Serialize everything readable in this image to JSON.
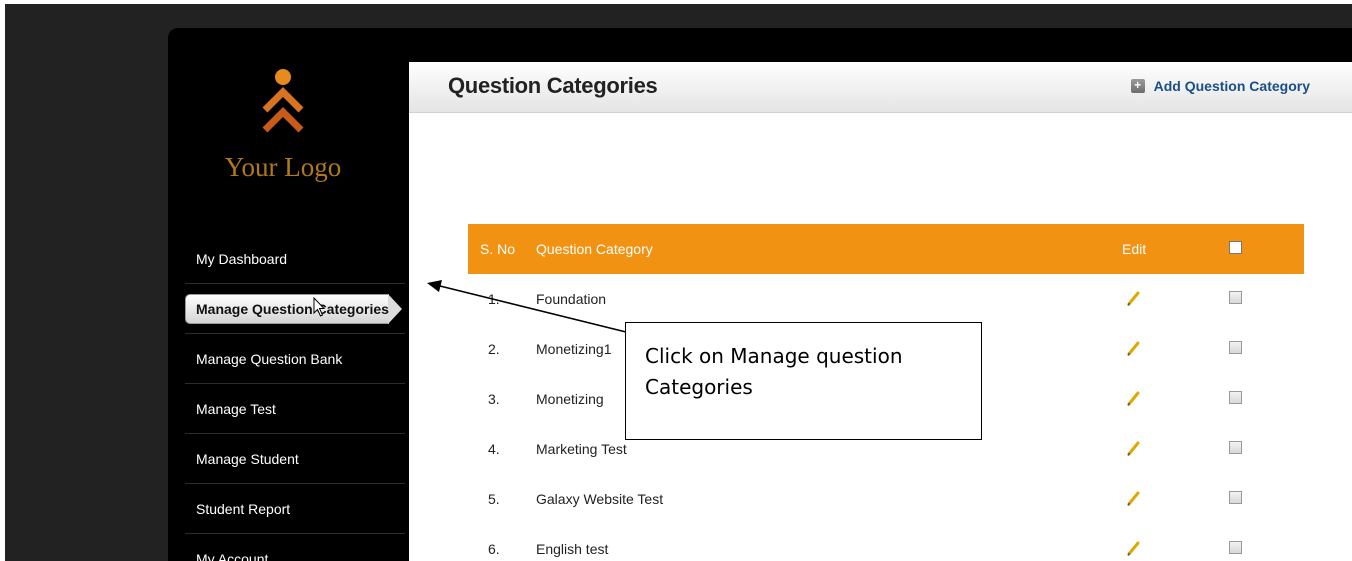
{
  "logo": {
    "text": "Your Logo"
  },
  "sidebar": {
    "items": [
      {
        "label": "My Dashboard"
      },
      {
        "label": "Manage Question Categories"
      },
      {
        "label": "Manage Question Bank"
      },
      {
        "label": "Manage Test"
      },
      {
        "label": "Manage Student"
      },
      {
        "label": "Student Report"
      },
      {
        "label": "My Account"
      }
    ]
  },
  "header": {
    "title": "Question Categories",
    "add_label": "Add Question Category"
  },
  "table": {
    "columns": [
      "S. No",
      "Question Category",
      "Edit"
    ],
    "rows": [
      {
        "sno": "1.",
        "category": "Foundation"
      },
      {
        "sno": "2.",
        "category": "Monetizing1"
      },
      {
        "sno": "3.",
        "category": "Monetizing"
      },
      {
        "sno": "4.",
        "category": "Marketing Test"
      },
      {
        "sno": "5.",
        "category": "Galaxy Website Test"
      },
      {
        "sno": "6.",
        "category": "English test"
      }
    ]
  },
  "callout": {
    "line1": "Click on Manage question",
    "line2": "Categories"
  },
  "colors": {
    "accent": "#f29213",
    "link": "#1a4f86",
    "logo": "#d9731f"
  }
}
